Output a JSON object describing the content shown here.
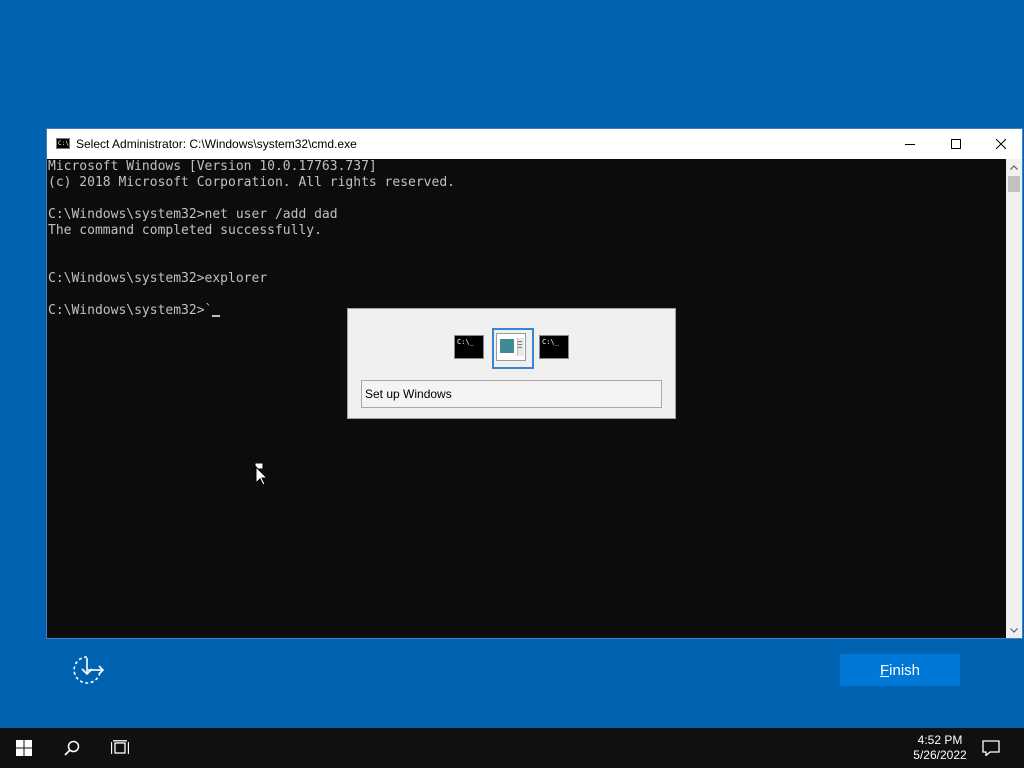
{
  "window": {
    "title": "Select Administrator: C:\\Windows\\system32\\cmd.exe",
    "app_icon_text": "C:\\",
    "minimize_icon": "minimize-icon",
    "maximize_icon": "maximize-icon",
    "close_icon": "close-icon"
  },
  "console": {
    "lines": [
      "Microsoft Windows [Version 10.0.17763.737]",
      "(c) 2018 Microsoft Corporation. All rights reserved.",
      "",
      "C:\\Windows\\system32>net user /add dad",
      "The command completed successfully.",
      "",
      "",
      "C:\\Windows\\system32>explorer",
      "",
      "C:\\Windows\\system32>`"
    ]
  },
  "switcher": {
    "items": [
      {
        "name": "command-prompt-thumbnail",
        "text": "C:\\_"
      },
      {
        "name": "setup-windows-thumbnail",
        "text": ""
      },
      {
        "name": "command-prompt-thumbnail-2",
        "text": "C:\\_"
      }
    ],
    "selected_label": "Set up Windows"
  },
  "setup": {
    "finish_label": "Finish",
    "finish_accel": "F",
    "finish_rest": "inish",
    "accessibility_icon": "ease-of-access-icon"
  },
  "taskbar": {
    "time": "4:52 PM",
    "date": "5/26/2022",
    "icons": [
      "windows-start-icon",
      "search-icon",
      "task-view-icon",
      "notification-icon"
    ]
  },
  "colors": {
    "desktop": "#0063b1",
    "console_bg": "#0c0c0c",
    "console_text": "#c0c0c0",
    "accent": "#0078d7",
    "taskbar": "#101010"
  }
}
